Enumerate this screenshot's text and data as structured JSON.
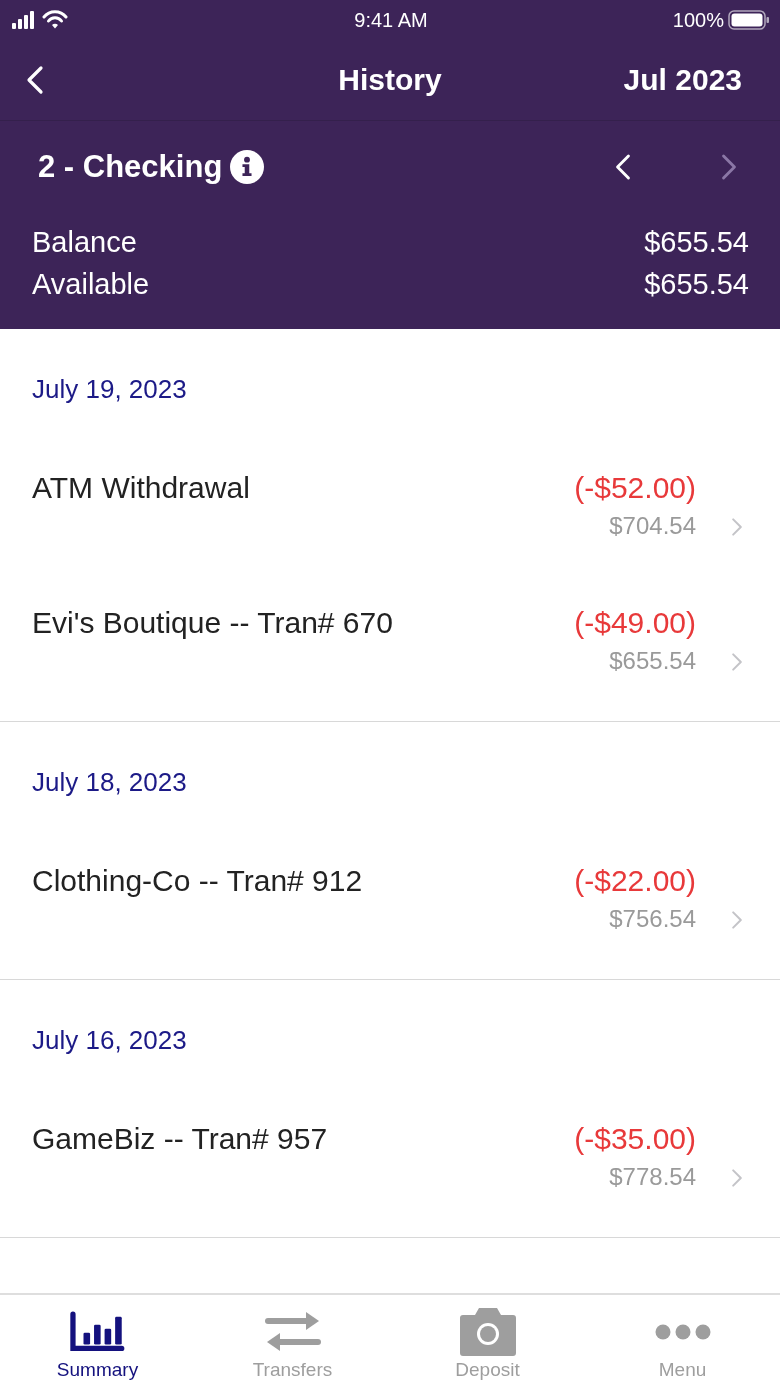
{
  "status_bar": {
    "time": "9:41 AM",
    "battery": "100%"
  },
  "nav": {
    "title": "History",
    "period": "Jul 2023"
  },
  "account": {
    "name": "2 - Checking",
    "prev_disabled": false,
    "next_disabled": true,
    "figures": [
      {
        "label": "Balance",
        "value": "$655.54"
      },
      {
        "label": "Available",
        "value": "$655.54"
      }
    ]
  },
  "groups": [
    {
      "date": "July 19, 2023",
      "transactions": [
        {
          "description": "ATM Withdrawal",
          "amount": "(-$52.00)",
          "kind": "debit",
          "balance": "$704.54"
        },
        {
          "description": "Evi's Boutique -- Tran# 670",
          "amount": "(-$49.00)",
          "kind": "debit",
          "balance": "$655.54"
        }
      ]
    },
    {
      "date": "July 18, 2023",
      "transactions": [
        {
          "description": "Clothing-Co -- Tran# 912",
          "amount": "(-$22.00)",
          "kind": "debit",
          "balance": "$756.54"
        }
      ]
    },
    {
      "date": "July 16, 2023",
      "transactions": [
        {
          "description": "GameBiz -- Tran# 957",
          "amount": "(-$35.00)",
          "kind": "debit",
          "balance": "$778.54"
        }
      ]
    }
  ],
  "tabs": [
    {
      "label": "Summary",
      "kind": "chart",
      "selected": true
    },
    {
      "label": "Transfers",
      "kind": "arrows",
      "selected": false
    },
    {
      "label": "Deposit",
      "kind": "camera",
      "selected": false
    },
    {
      "label": "Menu",
      "kind": "dots",
      "selected": false
    }
  ]
}
